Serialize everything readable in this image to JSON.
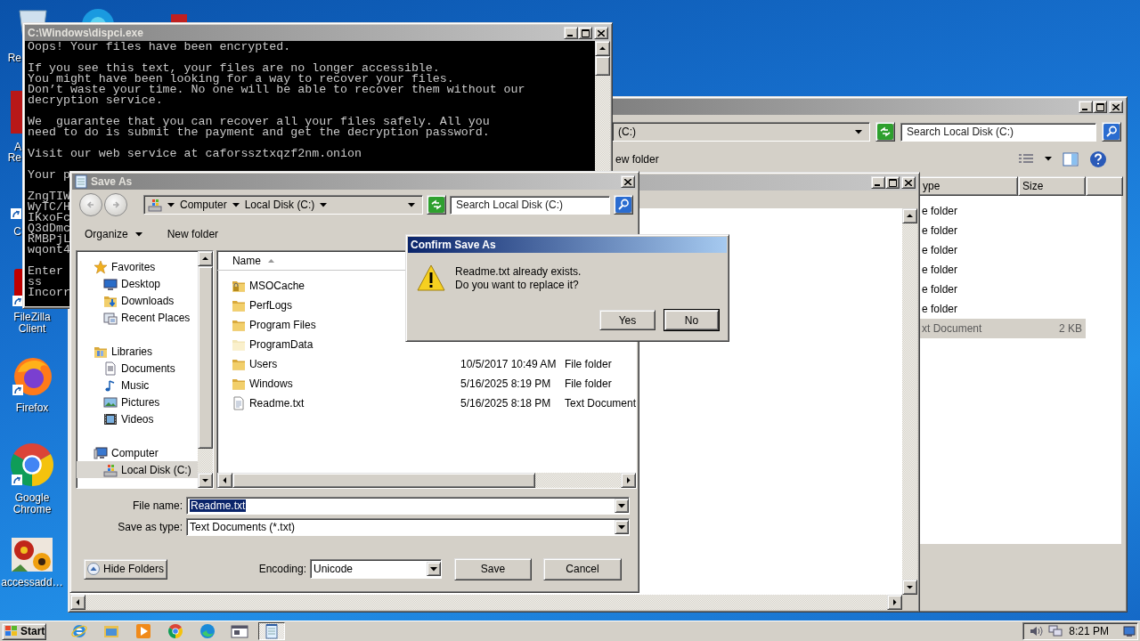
{
  "desktop": {
    "cut_labels": [
      "Re",
      "A",
      "Re",
      "C"
    ],
    "icons": [
      {
        "label": "FileZilla Client",
        "kind": "filezilla"
      },
      {
        "label": "Firefox",
        "kind": "firefox"
      },
      {
        "label": "Google Chrome",
        "kind": "chrome"
      },
      {
        "label": "accessadd…",
        "kind": "picture"
      }
    ]
  },
  "console": {
    "title": "C:\\Windows\\dispci.exe",
    "active": false,
    "paragraphs": [
      [
        "Oops! Your files have been encrypted."
      ],
      [
        "If you see this text, your files are no longer accessible.",
        "You might have been looking for a way to recover your files.",
        "Don’t waste your time. No one will be able to recover them without our",
        "decryption service."
      ],
      [
        "We  guarantee that you can recover all your files safely. All you",
        "need to do is submit the payment and get the decryption password."
      ],
      [
        "Visit our web service at caforssztxqzf2nm.onion"
      ],
      [
        "Your p"
      ],
      [
        "ZngTIW",
        "WyTC/H",
        "IKxoFc",
        "Q3dDmc",
        "RMBPjL",
        "wqont4"
      ],
      [
        "Enter",
        "ss",
        "Incorr"
      ]
    ]
  },
  "explorer": {
    "active": false,
    "address": "(C:)",
    "search": {
      "placeholder": "Search Local Disk (C:)"
    },
    "toolbar": [
      "ew folder"
    ],
    "columns": [
      "ype",
      "Size"
    ],
    "rows": [
      {
        "type": "e folder",
        "selected": false
      },
      {
        "type": "e folder",
        "selected": false
      },
      {
        "type": "e folder",
        "selected": false
      },
      {
        "type": "e folder",
        "selected": false
      },
      {
        "type": "e folder",
        "selected": false
      },
      {
        "type": "e folder",
        "selected": false
      },
      {
        "type": "xt Document",
        "size": "2 KB",
        "selected": true
      }
    ]
  },
  "save_as": {
    "title": "Save As",
    "active": false,
    "breadcrumb": [
      "Computer",
      "Local Disk (C:)"
    ],
    "search": {
      "placeholder": "Search Local Disk (C:)"
    },
    "toolbar": [
      {
        "label": "Organize",
        "dropdown": true
      },
      {
        "label": "New folder",
        "dropdown": false
      }
    ],
    "nav": [
      {
        "label": "Favorites",
        "kind": "star",
        "children": [
          {
            "label": "Desktop",
            "kind": "desktop",
            "selected": false
          },
          {
            "label": "Downloads",
            "kind": "downloads",
            "selected": false
          },
          {
            "label": "Recent Places",
            "kind": "recent",
            "selected": false
          }
        ]
      },
      {
        "label": "Libraries",
        "kind": "libraries",
        "children": [
          {
            "label": "Documents",
            "kind": "documents",
            "selected": false
          },
          {
            "label": "Music",
            "kind": "music",
            "selected": false
          },
          {
            "label": "Pictures",
            "kind": "pictures",
            "selected": false
          },
          {
            "label": "Videos",
            "kind": "videos",
            "selected": false
          }
        ]
      },
      {
        "label": "Computer",
        "kind": "computer",
        "children": [
          {
            "label": "Local Disk (C:)",
            "kind": "disk",
            "selected": true
          }
        ]
      }
    ],
    "columns": [
      "Name"
    ],
    "files": [
      {
        "name": "MSOCache",
        "kind": "locked-folder"
      },
      {
        "name": "PerfLogs",
        "kind": "folder"
      },
      {
        "name": "Program Files",
        "kind": "folder"
      },
      {
        "name": "ProgramData",
        "kind": "hidden-folder"
      },
      {
        "name": "Users",
        "kind": "folder",
        "date": "10/5/2017 10:49 AM",
        "type": "File folder"
      },
      {
        "name": "Windows",
        "kind": "folder",
        "date": "5/16/2025 8:19 PM",
        "type": "File folder"
      },
      {
        "name": "Readme.txt",
        "kind": "text",
        "date": "5/16/2025 8:18 PM",
        "type": "Text Document"
      }
    ],
    "file_name": {
      "label": "File name:",
      "value": "Readme.txt",
      "selected": true
    },
    "save_as_type": {
      "label": "Save as type:",
      "value": "Text Documents (*.txt)"
    },
    "hide_folders": "Hide Folders",
    "encoding": {
      "label": "Encoding:",
      "value": "Unicode"
    },
    "buttons": [
      "Save",
      "Cancel"
    ]
  },
  "confirm": {
    "title": "Confirm Save As",
    "active": true,
    "message": [
      "Readme.txt already exists.",
      "Do you want to replace it?"
    ],
    "buttons": [
      {
        "label": "Yes",
        "default": false
      },
      {
        "label": "No",
        "default": true
      }
    ]
  },
  "taskbar": {
    "start": "Start",
    "apps": [
      {
        "kind": "ie",
        "active": false
      },
      {
        "kind": "explorer",
        "active": false
      },
      {
        "kind": "media",
        "active": false
      },
      {
        "kind": "chrome",
        "active": false
      },
      {
        "kind": "edge",
        "active": false
      },
      {
        "kind": "window",
        "active": false
      },
      {
        "kind": "notepad",
        "active": true
      }
    ],
    "clock": "8:21 PM"
  }
}
